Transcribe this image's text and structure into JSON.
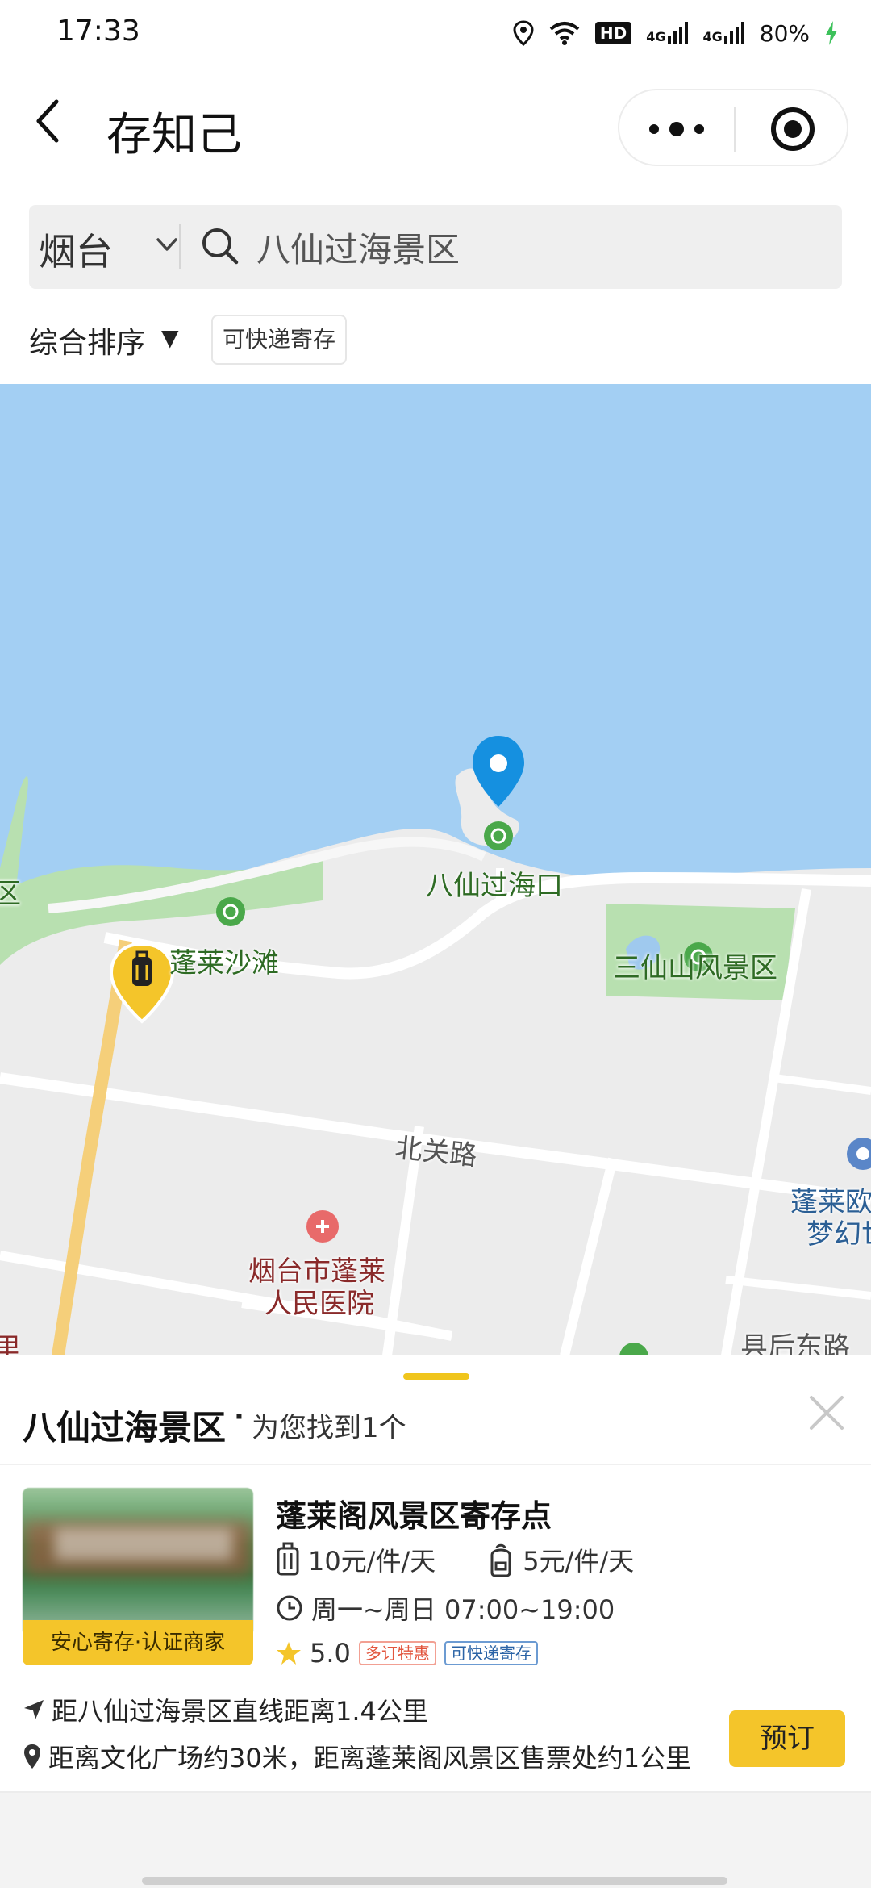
{
  "status_bar": {
    "time": "17:33",
    "hd": "HD",
    "net1": "4G",
    "net2": "4G",
    "battery": "80%"
  },
  "nav": {
    "title": "存知己"
  },
  "search": {
    "city": "烟台",
    "query": "八仙过海景区"
  },
  "filters": {
    "sort": "综合排序",
    "sort_caret": "▼",
    "express_chip": "可快递寄存"
  },
  "map": {
    "labels": {
      "baxian": "八仙过海口",
      "penglai_beach": "蓬莱沙滩",
      "sanxian": "三仙山风景区",
      "beiguan_road": "北关路",
      "hospital_line1": "烟台市蓬莱",
      "hospital_line2": "人民医院",
      "ou_line1": "蓬莱欧",
      "ou_line2": "梦幻世",
      "xianhou_road": "县后东路",
      "edge_left_top": "区",
      "edge_left_bottom": "里"
    }
  },
  "panel": {
    "title": "八仙过海景区",
    "dot": "·",
    "subtitle": "为您找到1个",
    "shop": {
      "name": "蓬莱阁风景区寄存点",
      "badge": "安心寄存·认证商家",
      "price_large": "10元/件/天",
      "price_small": "5元/件/天",
      "hours": "周一~周日 07:00~19:00",
      "rating": "5.0",
      "tag_discount": "多订特惠",
      "tag_express": "可快递寄存",
      "distance_line": "距八仙过海景区直线距离1.4公里",
      "address_line": "距离文化广场约30米，距离蓬莱阁风景区售票处约1公里",
      "book_label": "预订"
    }
  },
  "colors": {
    "accent_yellow": "#f4c52a",
    "sea_blue": "#a3cff3",
    "land_gray": "#eeeeee",
    "park_green": "#b8e0b0",
    "marker_blue": "#1590e0"
  }
}
